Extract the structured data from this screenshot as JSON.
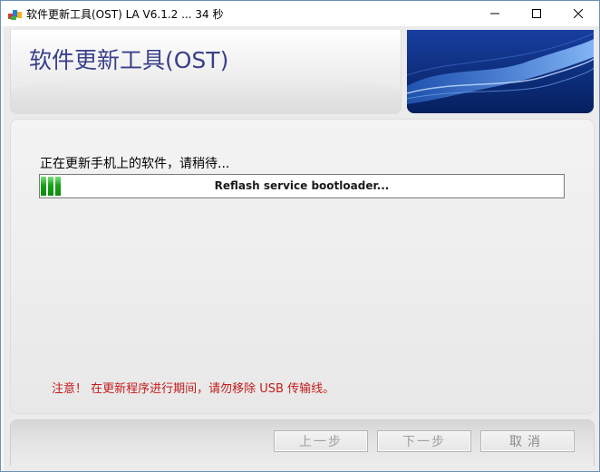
{
  "window": {
    "title": "软件更新工具(OST) LA V6.1.2 ... 34 秒",
    "icon": "app-logo-icon",
    "controls": [
      "minimize-icon",
      "maximize-icon",
      "close-icon"
    ]
  },
  "header": {
    "title": "软件更新工具(OST)"
  },
  "content": {
    "status_text": "正在更新手机上的软件，请稍待...",
    "progress": {
      "label": "Reflash service bootloader...",
      "segments_filled": 3,
      "color": "#1aa01a"
    },
    "warning_text": "注意！ 在更新程序进行期间，请勿移除 USB 传输线。",
    "warning_color": "#c41a1a"
  },
  "footer": {
    "prev_label": "上一步",
    "next_label": "下一步",
    "cancel_label": "取消"
  },
  "colors": {
    "title_accent": "#3a3f8c",
    "banner_blue": "#0d2f86"
  }
}
